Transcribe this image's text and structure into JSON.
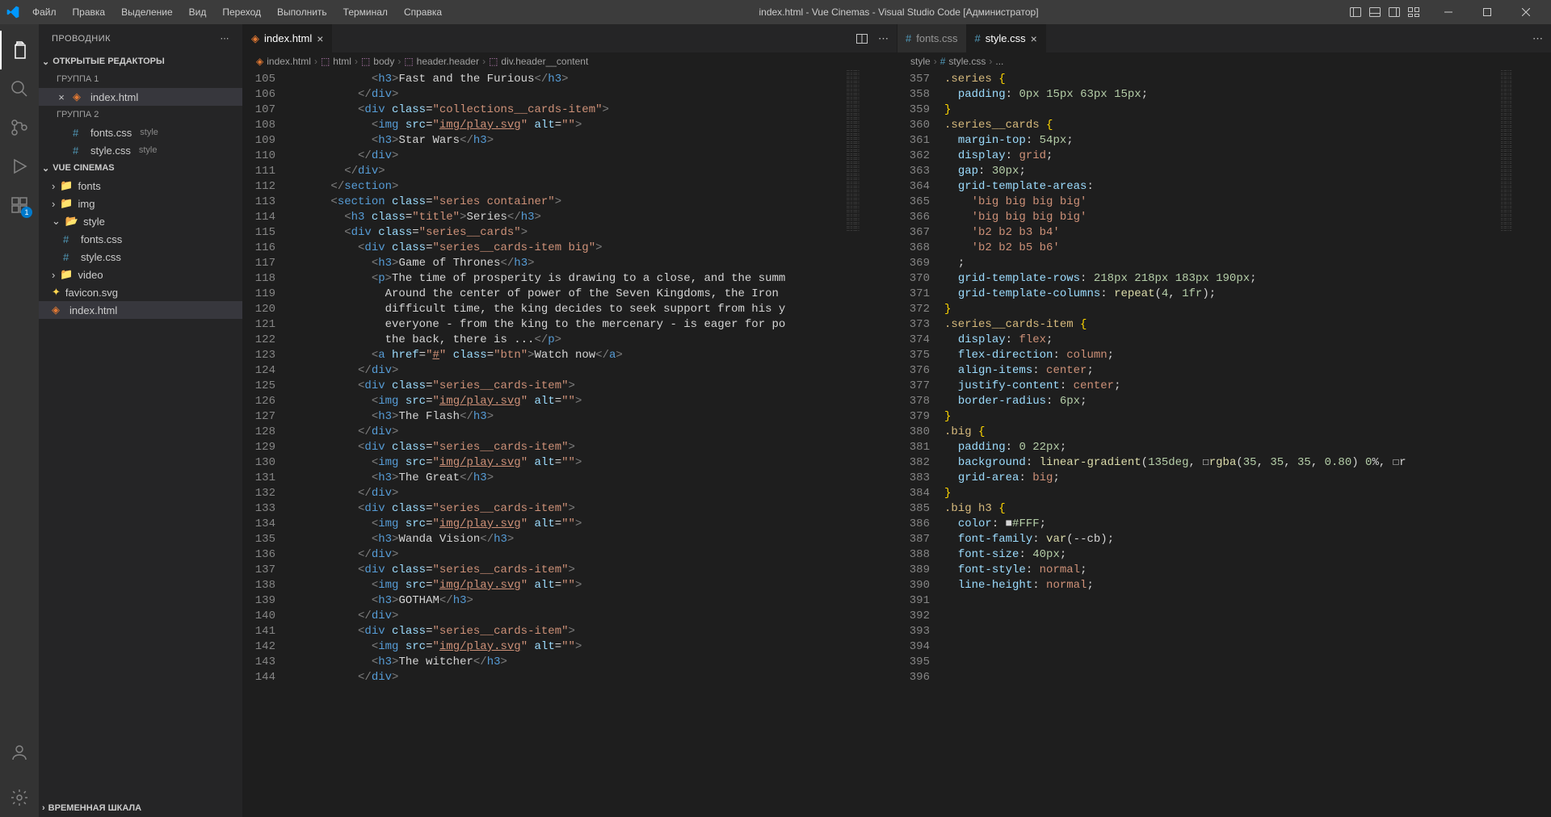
{
  "titlebar": {
    "menu": [
      "Файл",
      "Правка",
      "Выделение",
      "Вид",
      "Переход",
      "Выполнить",
      "Терминал",
      "Справка"
    ],
    "title": "index.html - Vue Cinemas - Visual Studio Code [Администратор]"
  },
  "sidebar": {
    "title": "ПРОВОДНИК",
    "open_editors": "ОТКРЫТЫЕ РЕДАКТОРЫ",
    "group1": "ГРУППА 1",
    "group2": "ГРУППА 2",
    "project": "VUE CINEMAS",
    "timeline": "ВРЕМЕННАЯ ШКАЛА",
    "files": {
      "index": "index.html",
      "fonts_css": "fonts.css",
      "style_css": "style.css",
      "fonts_dir": "fonts",
      "img_dir": "img",
      "style_dir": "style",
      "video_dir": "video",
      "favicon": "favicon.svg",
      "style_desc": "style"
    }
  },
  "editor1": {
    "tab": "index.html",
    "breadcrumbs": [
      "index.html",
      "html",
      "body",
      "header.header",
      "div.header__content"
    ],
    "lines_start": 105,
    "lines": [
      "            <h3>Fast and the Furious</h3>",
      "          </div>",
      "          <div class=\"collections__cards-item\">",
      "            <img src=\"img/play.svg\" alt=\"\">",
      "            <h3>Star Wars</h3>",
      "          </div>",
      "        </div>",
      "      </section>",
      "      <section class=\"series container\">",
      "        <h3 class=\"title\">Series</h3>",
      "        <div class=\"series__cards\">",
      "          <div class=\"series__cards-item big\">",
      "            <h3>Game of Thrones</h3>",
      "            <p>The time of prosperity is drawing to a close, and the summ",
      "              Around the center of power of the Seven Kingdoms, the Iron",
      "              difficult time, the king decides to seek support from his y",
      "              everyone - from the king to the mercenary - is eager for po",
      "              the back, there is ...</p>",
      "            <a href=\"#\" class=\"btn\">Watch now</a>",
      "          </div>",
      "          <div class=\"series__cards-item\">",
      "            <img src=\"img/play.svg\" alt=\"\">",
      "            <h3>The Flash</h3>",
      "          </div>",
      "          <div class=\"series__cards-item\">",
      "            <img src=\"img/play.svg\" alt=\"\">",
      "            <h3>The Great</h3>",
      "          </div>",
      "          <div class=\"series__cards-item\">",
      "            <img src=\"img/play.svg\" alt=\"\">",
      "            <h3>Wanda Vision</h3>",
      "          </div>",
      "          <div class=\"series__cards-item\">",
      "            <img src=\"img/play.svg\" alt=\"\">",
      "            <h3>GOTHAM</h3>",
      "          </div>",
      "          <div class=\"series__cards-item\">",
      "            <img src=\"img/play.svg\" alt=\"\">",
      "            <h3>The witcher</h3>",
      "          </div>"
    ]
  },
  "editor2": {
    "tab1": "fonts.css",
    "tab2": "style.css",
    "breadcrumbs": [
      "style",
      "style.css",
      "..."
    ],
    "lines_start": 357,
    "lines": [
      ".series {",
      "  padding: 0px 15px 63px 15px;",
      "}",
      "",
      ".series__cards {",
      "  margin-top: 54px;",
      "  display: grid;",
      "  gap: 30px;",
      "  grid-template-areas:",
      "    'big big big big'",
      "    'big big big big'",
      "    'b2 b2 b3 b4'",
      "    'b2 b2 b5 b6'",
      "  ;",
      "  grid-template-rows: 218px 218px 183px 190px;",
      "  grid-template-columns: repeat(4, 1fr);",
      "}",
      "",
      ".series__cards-item {",
      "  display: flex;",
      "  flex-direction: column;",
      "  align-items: center;",
      "  justify-content: center;",
      "  border-radius: 6px;",
      "}",
      "",
      ".big {",
      "  padding: 0 22px;",
      "  background: linear-gradient(135deg, ☐rgba(35, 35, 35, 0.80) 0%, ☐r",
      "",
      "  grid-area: big;",
      "}",
      "",
      ".big h3 {",
      "  color: ■#FFF;",
      "  font-family: var(--cb);",
      "  font-size: 40px;",
      "  font-style: normal;",
      "",
      "  line-height: normal;"
    ]
  },
  "ext_badge": "1"
}
